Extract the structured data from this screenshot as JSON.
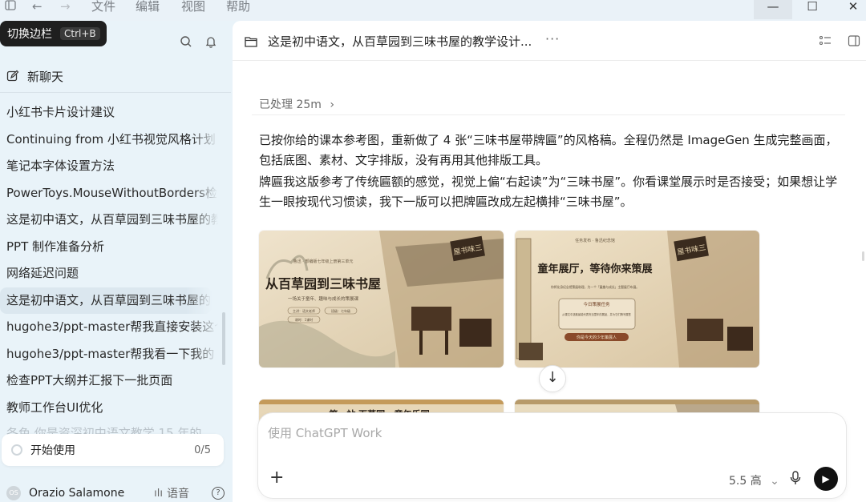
{
  "titlebar": {
    "menu": [
      "文件",
      "编辑",
      "视图",
      "帮助"
    ],
    "window_buttons": {
      "minimize": "—",
      "maximize": "☐",
      "close": "✕"
    }
  },
  "sidebar": {
    "tooltip": {
      "label": "切换边栏",
      "shortcut": "Ctrl+B"
    },
    "new_chat": "新聊天",
    "history": [
      "小红书卡片设计建议",
      "Continuing from 小红书视觉风格计划",
      "笔记本字体设置方法",
      "PowerToys.MouseWithoutBorders检测",
      "这是初中语文，从百草园到三味书屋的教学",
      "PPT 制作准备分析",
      "网络延迟问题",
      "这是初中语文，从百草园到三味书屋的教学",
      "hugohe3/ppt-master帮我直接安装这个",
      "hugohe3/ppt-master帮我看一下我的",
      "检查PPT大纲并汇报下一批页面",
      "教师工作台UI优化"
    ],
    "active_index": 7,
    "faded_item": "各色 你是资深初中语文教学 15 年的",
    "start": {
      "label": "开始使用",
      "count": "0/5"
    },
    "user": {
      "name": "Orazio Salamone",
      "initials": "OS",
      "voice_label": "语音",
      "help": "?"
    }
  },
  "main": {
    "title": "这是初中语文，从百草园到三味书屋的教学设计...",
    "processed": "已处理 25m",
    "paragraphs": [
      "已按你给的课本参考图，重新做了 4 张“三味书屋带牌匾”的风格稿。全程仍然是 ImageGen 生成完整画面，包括底图、素材、文字排版，没有再用其他排版工具。",
      "牌匾我这版参考了传统匾额的感觉，视觉上偏“右起读”为“三味书屋”。你看课堂展示时是否接受；如果想让学生一眼按现代习惯读，我下一版可以把牌匾改成左起横排“三味书屋”。"
    ],
    "images": [
      {
        "main_title": "从百草园到三味书屋",
        "top_caption": "鲁迅 · 部编版七年级上册第三单元",
        "subtitle": "一场关于童年、趣味与成长的策展课",
        "tags": [
          "主讲：语文老师",
          "课时：1课时",
          "班级：七年级"
        ],
        "plaque": "屋书味三"
      },
      {
        "top_caption": "任务发布 · 鲁迅纪念馆",
        "main_title": "童年展厅，等待你来策展",
        "subtitle": "你将化身纪念馆策展助理，为一个「童趣与成长」主题展厅布展。",
        "box_title": "今日策展任务",
        "box_text": "从课文中选取最能代表鲁迅童年的展品，并为它们撰写展签",
        "cta": "你是今天的少年策展人",
        "plaque": "屋书味三"
      },
      {
        "partial_text": "第一站 百草园 · 童年乐园"
      },
      {
        "partial_text": ""
      }
    ],
    "composer": {
      "placeholder": "使用 ChatGPT Work",
      "model": "5.5 高"
    }
  }
}
